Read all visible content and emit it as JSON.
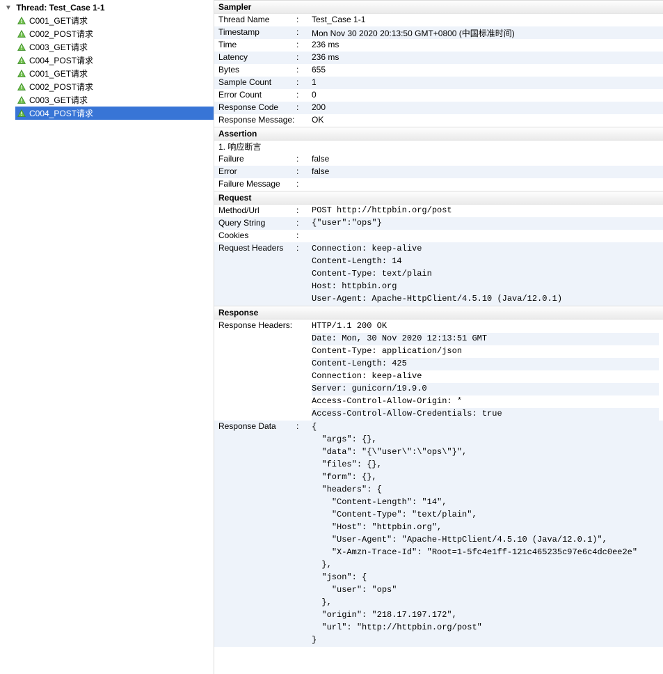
{
  "sidebar": {
    "thread_label": "Thread: Test_Case 1-1",
    "items": [
      {
        "label": "C001_GET请求",
        "selected": false
      },
      {
        "label": "C002_POST请求",
        "selected": false
      },
      {
        "label": "C003_GET请求",
        "selected": false
      },
      {
        "label": "C004_POST请求",
        "selected": false
      },
      {
        "label": "C001_GET请求",
        "selected": false
      },
      {
        "label": "C002_POST请求",
        "selected": false
      },
      {
        "label": "C003_GET请求",
        "selected": false
      },
      {
        "label": "C004_POST请求",
        "selected": true
      }
    ]
  },
  "sections": {
    "sampler": {
      "header": "Sampler",
      "rows": [
        {
          "key": "Thread Name",
          "value": "Test_Case 1-1",
          "plain": true
        },
        {
          "key": "Timestamp",
          "value": "Mon Nov 30 2020 20:13:50 GMT+0800 (中国标准时间)",
          "plain": true
        },
        {
          "key": "Time",
          "value": "236 ms",
          "plain": true
        },
        {
          "key": "Latency",
          "value": "236 ms",
          "plain": true
        },
        {
          "key": "Bytes",
          "value": "655",
          "plain": true
        },
        {
          "key": "Sample Count",
          "value": "1",
          "plain": true
        },
        {
          "key": "Error Count",
          "value": "0",
          "plain": true
        },
        {
          "key": "Response Code",
          "value": "200",
          "plain": true
        },
        {
          "key": "Response Message",
          "value": "OK",
          "plain": true,
          "nocolon": true
        }
      ]
    },
    "assertion": {
      "header": "Assertion",
      "title": "1. 响应断言",
      "rows": [
        {
          "key": "Failure",
          "value": "false",
          "plain": true
        },
        {
          "key": "Error",
          "value": "false",
          "plain": true
        },
        {
          "key": "Failure Message",
          "value": "",
          "plain": true
        }
      ]
    },
    "request": {
      "header": "Request",
      "rows": [
        {
          "key": "Method/Url",
          "value": "POST http://httpbin.org/post"
        },
        {
          "key": "Query String",
          "value": "{\"user\":\"ops\"}"
        },
        {
          "key": "Cookies",
          "value": ""
        },
        {
          "key": "Request Headers",
          "value_lines": [
            "Connection: keep-alive",
            "Content-Length: 14",
            "Content-Type: text/plain",
            "Host: httpbin.org",
            "User-Agent: Apache-HttpClient/4.5.10 (Java/12.0.1)"
          ]
        }
      ]
    },
    "response": {
      "header": "Response",
      "rows": [
        {
          "key": "Response Headers",
          "nocolon": true,
          "value_lines": [
            "HTTP/1.1 200 OK",
            "Date: Mon, 30 Nov 2020 12:13:51 GMT",
            "Content-Type: application/json",
            "Content-Length: 425",
            "Connection: keep-alive",
            "Server: gunicorn/19.9.0",
            "Access-Control-Allow-Origin: *",
            "Access-Control-Allow-Credentials: true"
          ]
        },
        {
          "key": "Response Data",
          "stripe_offset": true,
          "value_lines": [
            "{",
            "  \"args\": {},",
            "  \"data\": \"{\\\"user\\\":\\\"ops\\\"}\",",
            "  \"files\": {},",
            "  \"form\": {},",
            "  \"headers\": {",
            "    \"Content-Length\": \"14\",",
            "    \"Content-Type\": \"text/plain\",",
            "    \"Host\": \"httpbin.org\",",
            "    \"User-Agent\": \"Apache-HttpClient/4.5.10 (Java/12.0.1)\",",
            "    \"X-Amzn-Trace-Id\": \"Root=1-5fc4e1ff-121c465235c97e6c4dc0ee2e\"",
            "  },",
            "  \"json\": {",
            "    \"user\": \"ops\"",
            "  },",
            "  \"origin\": \"218.17.197.172\",",
            "  \"url\": \"http://httpbin.org/post\"",
            "}"
          ]
        }
      ]
    }
  }
}
